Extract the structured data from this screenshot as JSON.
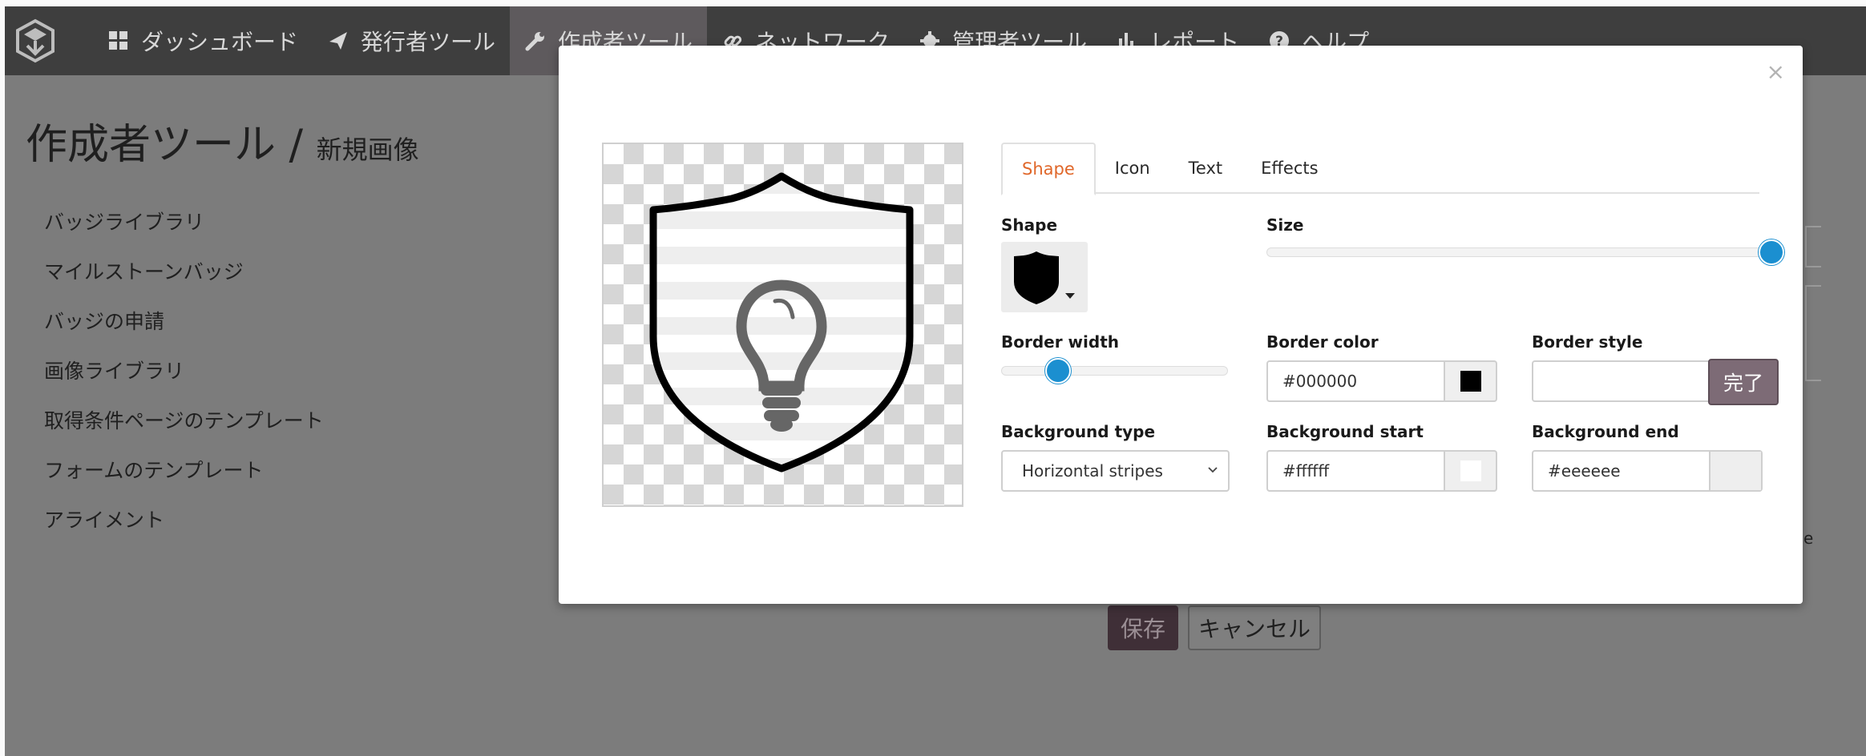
{
  "navbar": {
    "items": [
      {
        "label": "ダッシュボード",
        "icon": "grid-icon"
      },
      {
        "label": "発行者ツール",
        "icon": "paper-plane-icon"
      },
      {
        "label": "作成者ツール",
        "icon": "wrench-icon"
      },
      {
        "label": "ネットワーク",
        "icon": "link-icon"
      },
      {
        "label": "管理者ツール",
        "icon": "gear-icon"
      },
      {
        "label": "レポート",
        "icon": "bar-chart-icon"
      },
      {
        "label": "ヘルプ",
        "icon": "question-circle-icon"
      }
    ],
    "active_index": 2
  },
  "page": {
    "title": "作成者ツール",
    "separator": "/",
    "subtitle": "新規画像"
  },
  "side_menu": [
    "バッジライブラリ",
    "マイルストーンバッジ",
    "バッジの申請",
    "画像ライブラリ",
    "取得条件ページのテンプレート",
    "フォームのテンプレート",
    "アライメント"
  ],
  "background_form": {
    "save_label": "保存",
    "cancel_label": "キャンセル",
    "partial_text": "e"
  },
  "modal": {
    "close_label": "×",
    "tabs": [
      "Shape",
      "Icon",
      "Text",
      "Effects"
    ],
    "active_tab": "Shape",
    "shape_label": "Shape",
    "size_label": "Size",
    "size_value": 1.0,
    "border_width_label": "Border width",
    "border_width_value": 0.25,
    "border_color_label": "Border color",
    "border_color_value": "#000000",
    "border_style_label": "Border style",
    "border_style_value": "",
    "background_type_label": "Background type",
    "background_type_value": "Horizontal stripes",
    "background_start_label": "Background start",
    "background_start_value": "#ffffff",
    "background_end_label": "Background end",
    "background_end_value": "#eeeeee",
    "done_label": "完了"
  },
  "colors": {
    "accent_tab": "#e0672a",
    "slider": "#1b8fd0",
    "done_button": "#7d6b76"
  }
}
